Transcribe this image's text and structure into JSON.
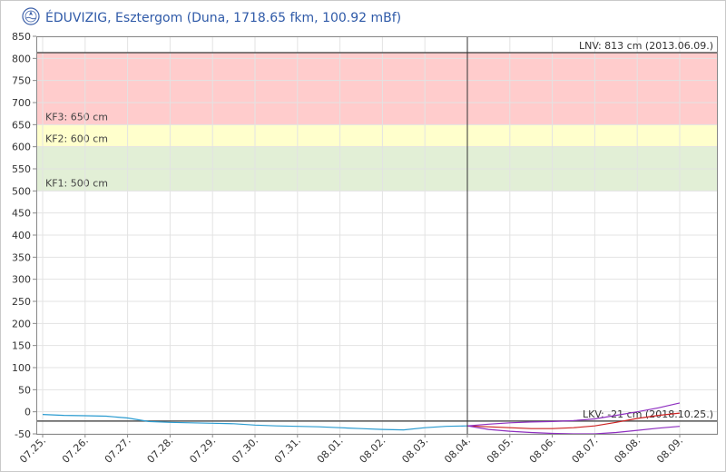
{
  "header": {
    "title": "ÉDUVIZIG, Esztergom (Duna, 1718.65 fkm, 100.92 mBf)"
  },
  "chart_data": {
    "type": "line",
    "title": "ÉDUVIZIG, Esztergom (Duna, 1718.65 fkm, 100.92 mBf)",
    "xlabel": "",
    "ylabel": "",
    "ylim": [
      -50,
      850
    ],
    "yticks": [
      -50,
      0,
      50,
      100,
      150,
      200,
      250,
      300,
      350,
      400,
      450,
      500,
      550,
      600,
      650,
      700,
      750,
      800,
      850
    ],
    "x_tick_labels": [
      "07.25.",
      "07.26.",
      "07.27.",
      "07.28.",
      "07.29.",
      "07.30.",
      "07.31.",
      "08.01.",
      "08.02.",
      "08.03.",
      "08.04.",
      "08.05.",
      "08.06.",
      "08.07.",
      "08.08.",
      "08.09."
    ],
    "grid": true,
    "current_marker_label": "08.04.",
    "zones": [
      {
        "label": "KF3: 650 cm",
        "from": 650,
        "to": 813,
        "color": "#ffcccc"
      },
      {
        "label": "KF2: 600 cm",
        "from": 600,
        "to": 650,
        "color": "#ffffcc"
      },
      {
        "label": "KF1: 500 cm",
        "from": 500,
        "to": 600,
        "color": "#e2efd6"
      }
    ],
    "reference_lines": [
      {
        "label": "LNV: 813 cm (2013.06.09.)",
        "value": 813,
        "color": "#555555"
      },
      {
        "label": "LKV: -21 cm (2018.10.25.)",
        "value": -21,
        "color": "#555555"
      }
    ],
    "series": [
      {
        "color": "#2a9bd0",
        "points": [
          [
            0,
            -6
          ],
          [
            0.5,
            -8
          ],
          [
            1,
            -9
          ],
          [
            1.5,
            -10
          ],
          [
            2,
            -14
          ],
          [
            2.5,
            -22
          ],
          [
            3,
            -24
          ],
          [
            3.5,
            -25
          ],
          [
            4,
            -26
          ],
          [
            4.5,
            -27
          ],
          [
            5,
            -30
          ],
          [
            5.5,
            -32
          ],
          [
            6,
            -33
          ],
          [
            6.5,
            -34
          ],
          [
            7,
            -36
          ],
          [
            7.5,
            -38
          ],
          [
            8,
            -40
          ],
          [
            8.5,
            -41
          ],
          [
            9,
            -36
          ],
          [
            9.5,
            -33
          ],
          [
            10,
            -32
          ]
        ]
      },
      {
        "color": "#cc2222",
        "points": [
          [
            10,
            -32
          ],
          [
            10.5,
            -34
          ],
          [
            11,
            -36
          ],
          [
            11.5,
            -38
          ],
          [
            12,
            -38
          ],
          [
            12.5,
            -36
          ],
          [
            13,
            -32
          ],
          [
            13.5,
            -24
          ],
          [
            14,
            -15
          ],
          [
            14.5,
            -8
          ],
          [
            15,
            -3
          ]
        ]
      },
      {
        "color": "#8e2fc0",
        "points": [
          [
            10,
            -32
          ],
          [
            10.5,
            -28
          ],
          [
            11,
            -25
          ],
          [
            11.5,
            -23
          ],
          [
            12,
            -22
          ],
          [
            12.5,
            -20
          ],
          [
            13,
            -16
          ],
          [
            13.5,
            -8
          ],
          [
            14,
            0
          ],
          [
            14.5,
            9
          ],
          [
            15,
            20
          ]
        ]
      },
      {
        "color": "#8e2fc0",
        "points": [
          [
            10,
            -32
          ],
          [
            10.5,
            -40
          ],
          [
            11,
            -44
          ],
          [
            11.5,
            -47
          ],
          [
            12,
            -49
          ],
          [
            12.5,
            -50
          ],
          [
            13,
            -50
          ],
          [
            13.5,
            -47
          ],
          [
            14,
            -42
          ],
          [
            14.5,
            -37
          ],
          [
            15,
            -33
          ]
        ]
      }
    ]
  }
}
